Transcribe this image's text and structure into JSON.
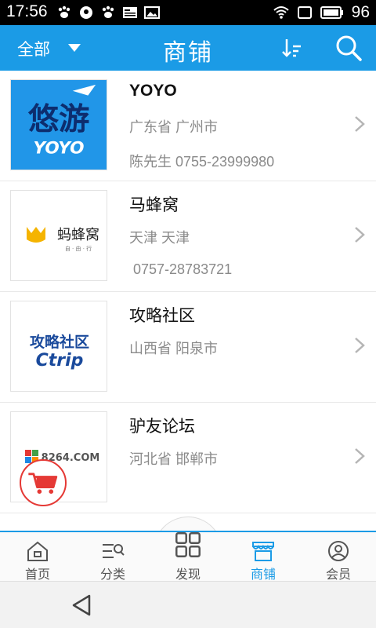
{
  "status_bar": {
    "time": "17:56",
    "battery": "96"
  },
  "header": {
    "filter_label": "全部",
    "title": "商铺"
  },
  "shops": [
    {
      "name": "YOYO",
      "region": "广东省 广州市",
      "phone": "陈先生 0755-23999980",
      "logo_text_top": "悠游",
      "logo_text_bottom": "YOYO"
    },
    {
      "name": "马蜂窝",
      "region": "天津 天津",
      "phone": " 0757-28783721",
      "logo_text": "蚂蜂窝",
      "logo_sub": "自 · 由 · 行"
    },
    {
      "name": "攻略社区",
      "region": "山西省 阳泉市",
      "logo_text_top": "攻略社区",
      "logo_text_bottom": "Ctrip"
    },
    {
      "name": "驴友论坛",
      "region": "河北省 邯郸市",
      "logo_text": "8264.COM"
    }
  ],
  "tabs": [
    {
      "label": "首页",
      "icon": "home-icon"
    },
    {
      "label": "分类",
      "icon": "category-icon"
    },
    {
      "label": "发现",
      "icon": "grid-icon"
    },
    {
      "label": "商铺",
      "icon": "store-icon"
    },
    {
      "label": "会员",
      "icon": "user-icon"
    }
  ],
  "colors": {
    "accent": "#1b9be6",
    "yoyo_bg": "#2196e8",
    "cart_red": "#e53935"
  }
}
